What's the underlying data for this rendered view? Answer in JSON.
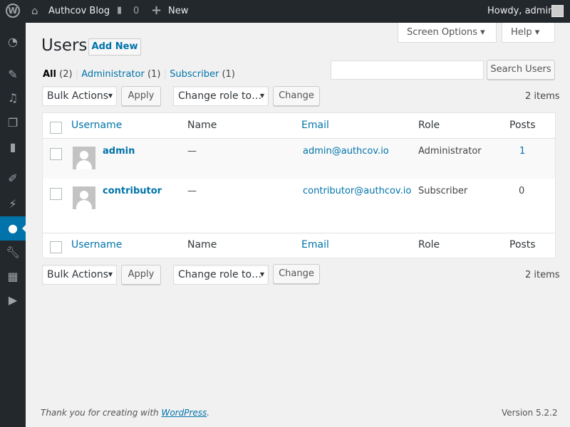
{
  "adminbar": {
    "site": "Authcov Blog",
    "comments": "0",
    "new": "New",
    "howdy": "Howdy, admin"
  },
  "screen_options": "Screen Options",
  "help": "Help",
  "page": {
    "title": "Users",
    "add_new": "Add New"
  },
  "filters": [
    {
      "label": "All",
      "count": "(2)"
    },
    {
      "label": "Administrator",
      "count": "(1)"
    },
    {
      "label": "Subscriber",
      "count": "(1)"
    }
  ],
  "search": {
    "value": "",
    "button": "Search Users"
  },
  "actions": {
    "bulk": "Bulk Actions",
    "apply": "Apply",
    "role": "Change role to…",
    "change": "Change",
    "count": "2 items"
  },
  "columns": {
    "username": "Username",
    "name": "Name",
    "email": "Email",
    "role": "Role",
    "posts": "Posts"
  },
  "rows": [
    {
      "username": "admin",
      "name": "—",
      "email": "admin@authcov.io",
      "role": "Administrator",
      "posts": "1"
    },
    {
      "username": "contributor",
      "name": "—",
      "email": "contributor@authcov.io",
      "role": "Subscriber",
      "posts": "0"
    }
  ],
  "footer": {
    "thanks": "Thank you for creating with ",
    "wp": "WordPress",
    "dot": ".",
    "version": "Version 5.2.2"
  },
  "colors": {
    "accent": "#0073aa",
    "bar": "#23282d"
  }
}
